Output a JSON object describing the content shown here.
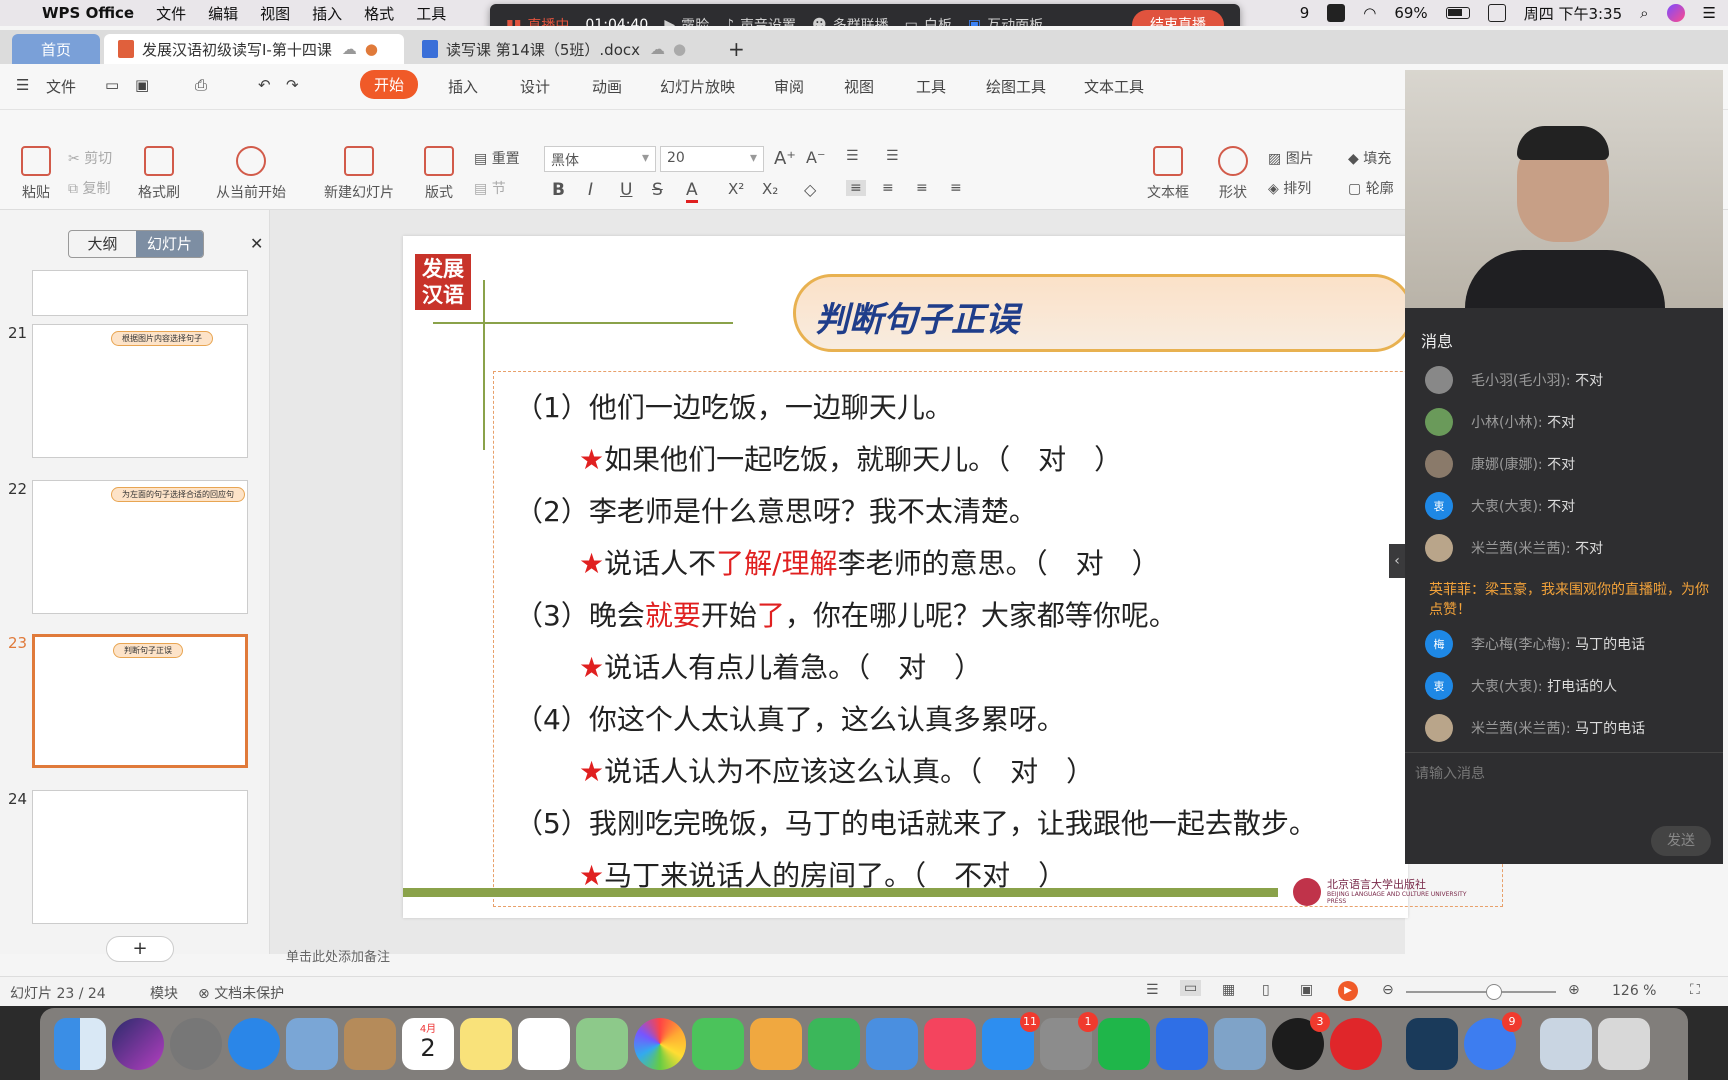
{
  "menubar": {
    "app_name": "WPS Office",
    "menus": [
      "文件",
      "编辑",
      "视图",
      "插入",
      "格式",
      "工具"
    ],
    "wifi_label": "9",
    "battery": "69%",
    "clock": "周四 下午3:35"
  },
  "live_bar": {
    "status": "直播中",
    "timer": "01:04:40",
    "items": [
      "露脸",
      "声音设置",
      "多群联播",
      "白板",
      "互动面板"
    ],
    "end_button": "结束直播"
  },
  "tabs": {
    "home": "首页",
    "doc1": "发展汉语初级读写I-第十四课",
    "doc2": "读写课 第14课（5班）.docx",
    "add": "+"
  },
  "ribbon": {
    "file_menu": "文件",
    "tabs": [
      "开始",
      "插入",
      "设计",
      "动画",
      "幻灯片放映",
      "审阅",
      "视图",
      "工具",
      "绘图工具",
      "文本工具"
    ],
    "active_tab": "开始"
  },
  "toolbar": {
    "paste": "粘贴",
    "cut": "剪切",
    "copy": "复制",
    "format_painter": "格式刷",
    "from_current": "从当前开始",
    "new_slide": "新建幻灯片",
    "layout": "版式",
    "reset": "重置",
    "section": "节",
    "font_name": "黑体",
    "font_size": "20",
    "textbox": "文本框",
    "shape": "形状",
    "picture": "图片",
    "arrange": "排列",
    "fill": "填充",
    "outline": "轮廓"
  },
  "left_panel": {
    "outline_tab": "大纲",
    "slides_tab": "幻灯片",
    "thumbs": [
      {
        "num": "21",
        "title": "根据图片内容选择句子"
      },
      {
        "num": "22",
        "title": "为左面的句子选择合适的回应句"
      },
      {
        "num": "23",
        "title": "判断句子正误"
      },
      {
        "num": "24",
        "title": ""
      }
    ],
    "add_slide": "+"
  },
  "slide": {
    "logo_line1": "发展",
    "logo_line2": "汉语",
    "title": "判断句子正误",
    "publisher": "北京语言大学出版社",
    "publisher_en": "BEIJING LANGUAGE AND CULTURE UNIVERSITY PRESS",
    "lines": [
      {
        "q": "（1）他们一边吃饭，一边聊天儿。"
      },
      {
        "a": "如果他们一起吃饭，就聊天儿。（　对　）"
      },
      {
        "q": "（2）李老师是什么意思呀？我不太清楚。"
      },
      {
        "a_pre": "说话人不",
        "a_red": "了解/理解",
        "a_post": "李老师的意思。（　对　）"
      },
      {
        "q_pre": "（3）晚会",
        "q_red1": "就要",
        "q_mid": "开始",
        "q_red2": "了",
        "q_post": "，你在哪儿呢？大家都等你呢。"
      },
      {
        "a": "说话人有点儿着急。（　对　）"
      },
      {
        "q": "（4）你这个人太认真了，这么认真多累呀。"
      },
      {
        "a": "说话人认为不应该这么认真。（　对　）"
      },
      {
        "q": "（5）我刚吃完晚饭，马丁的电话就来了，让我跟他一起去散步。"
      },
      {
        "a": "马丁来说话人的房间了。（　不对　）"
      }
    ],
    "star": "★"
  },
  "notes_placeholder": "单击此处添加备注",
  "chat": {
    "header": "消息",
    "messages": [
      {
        "nick": "毛小羽(毛小羽):",
        "text": "不对",
        "avatar": ""
      },
      {
        "nick": "小林(小林):",
        "text": "不对",
        "avatar": ""
      },
      {
        "nick": "康娜(康娜):",
        "text": "不对",
        "avatar": ""
      },
      {
        "nick": "大衷(大衷):",
        "text": "不对",
        "avatar": "衷"
      },
      {
        "nick": "米兰茜(米兰茜):",
        "text": "不对",
        "avatar": ""
      },
      {
        "nick": "李心梅(李心梅):",
        "text": "马丁的电话",
        "avatar": "梅"
      },
      {
        "nick": "大衷(大衷):",
        "text": "打电话的人",
        "avatar": "衷"
      },
      {
        "nick": "米兰茜(米兰茜):",
        "text": "马丁的电话",
        "avatar": ""
      }
    ],
    "system_msg": "英菲菲：梁玉豪，我来围观你的直播啦，为你点赞！",
    "input_placeholder": "请输入消息",
    "send": "发送"
  },
  "statusbar": {
    "slide_counter": "幻灯片 23 / 24",
    "template": "模块",
    "protection": "文档未保护",
    "zoom": "126 %"
  },
  "dock": {
    "calendar_month": "4月",
    "calendar_day": "2",
    "badges": {
      "appstore": "11",
      "settings": "1",
      "qq": "3",
      "feishu": "9"
    }
  }
}
